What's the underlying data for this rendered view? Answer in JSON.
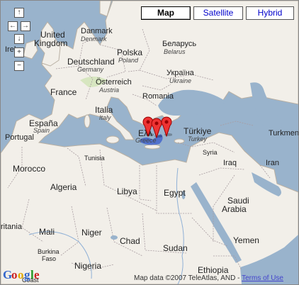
{
  "map_type_buttons": {
    "map": "Map",
    "satellite": "Satellite",
    "hybrid": "Hybrid",
    "active": "map"
  },
  "controls": {
    "pan_up": "↑",
    "pan_left": "←",
    "pan_right": "→",
    "pan_down": "↓",
    "zoom_in": "+",
    "zoom_out": "−"
  },
  "labels": {
    "united_kingdom_1": "United",
    "united_kingdom_2": "Kingdom",
    "ireland": "Irel",
    "denmark": "Danmark",
    "denmark_sub": "Denmark",
    "poland": "Polska",
    "poland_sub": "Poland",
    "belarus": "Беларусь",
    "belarus_sub": "Belarus",
    "germany": "Deutschland",
    "germany_sub": "Germany",
    "ukraine": "Україна",
    "ukraine_sub": "Ukraine",
    "france": "France",
    "austria": "Österreich",
    "austria_sub": "Austria",
    "romania": "Romania",
    "italy": "Italia",
    "italy_sub": "Italy",
    "spain": "España",
    "spain_sub": "Spain",
    "portugal": "Portugal",
    "greece": "Ελλ",
    "greece_sub": "Greece",
    "turkey": "Türkiye",
    "turkey_sub": "Turkey",
    "turkmen": "Turkmen",
    "syria": "Syria",
    "iraq": "Iraq",
    "iran": "Iran",
    "tunisia": "Tunisia",
    "morocco": "Morocco",
    "algeria": "Algeria",
    "libya": "Libya",
    "egypt": "Egypt",
    "saudi_1": "Saudi",
    "saudi_2": "Arabia",
    "mauritania": "ritania",
    "mali": "Mali",
    "niger": "Niger",
    "chad": "Chad",
    "sudan": "Sudan",
    "yemen": "Yemen",
    "burkina_1": "Burkina",
    "burkina_2": "Faso",
    "nigeria": "Nigeria",
    "ethiopia": "Ethiopia",
    "coast": "Coast"
  },
  "markers": [
    "marker-1",
    "marker-2",
    "marker-3"
  ],
  "footer": {
    "logo": "Google",
    "copyright": "Map data ©2007 TeleAtlas, AND - ",
    "terms": "Terms of Use"
  }
}
